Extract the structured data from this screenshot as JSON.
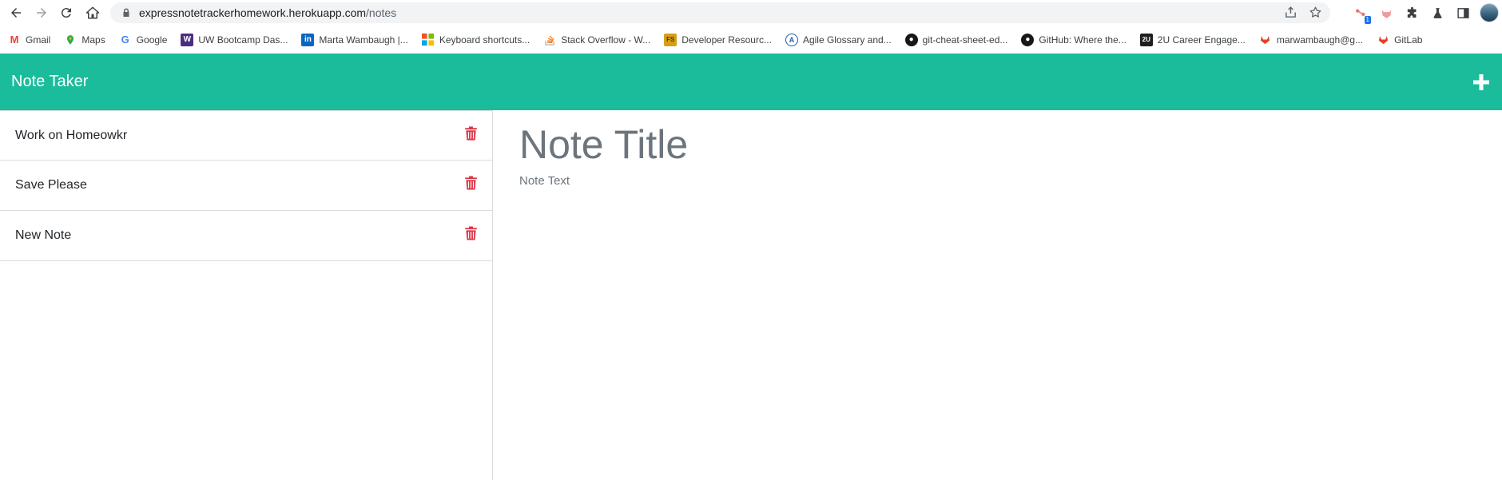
{
  "browser": {
    "url_host": "expressnotetrackerhomework.herokuapp.com",
    "url_path": "/notes",
    "extension_badge": "1"
  },
  "bookmarks": [
    {
      "label": "Gmail",
      "icon": "gmail-icon",
      "color": "#ea4335"
    },
    {
      "label": "Maps",
      "icon": "maps-pin-icon",
      "color": "#34a853"
    },
    {
      "label": "Google",
      "icon": "google-icon",
      "color": "#4285f4"
    },
    {
      "label": "UW Bootcamp Das...",
      "icon": "uw-icon",
      "color": "#4b2e83"
    },
    {
      "label": "Marta Wambaugh |...",
      "icon": "linkedin-icon",
      "color": "#0a66c2"
    },
    {
      "label": "Keyboard shortcuts...",
      "icon": "microsoft-icon",
      "color": "#f25022"
    },
    {
      "label": "Stack Overflow - W...",
      "icon": "stackoverflow-icon",
      "color": "#f48024"
    },
    {
      "label": "Developer Resourc...",
      "icon": "fs-icon",
      "color": "#d4a017"
    },
    {
      "label": "Agile Glossary and...",
      "icon": "agile-icon",
      "color": "#1f5fa8"
    },
    {
      "label": "git-cheat-sheet-ed...",
      "icon": "github-icon",
      "color": "#181717"
    },
    {
      "label": "GitHub: Where the...",
      "icon": "github-icon",
      "color": "#181717"
    },
    {
      "label": "2U Career Engage...",
      "icon": "2u-icon",
      "color": "#1e1e1e"
    },
    {
      "label": "marwambaugh@g...",
      "icon": "gitlab-icon",
      "color": "#e24329"
    },
    {
      "label": "GitLab",
      "icon": "gitlab-icon",
      "color": "#e24329"
    }
  ],
  "app": {
    "title": "Note Taker",
    "accent_color": "#1abc9c",
    "delete_color": "#dc3545"
  },
  "notes": [
    {
      "title": "Work on Homeowkr"
    },
    {
      "title": "Save Please"
    },
    {
      "title": "New Note"
    }
  ],
  "editor": {
    "title_placeholder": "Note Title",
    "text_placeholder": "Note Text"
  }
}
